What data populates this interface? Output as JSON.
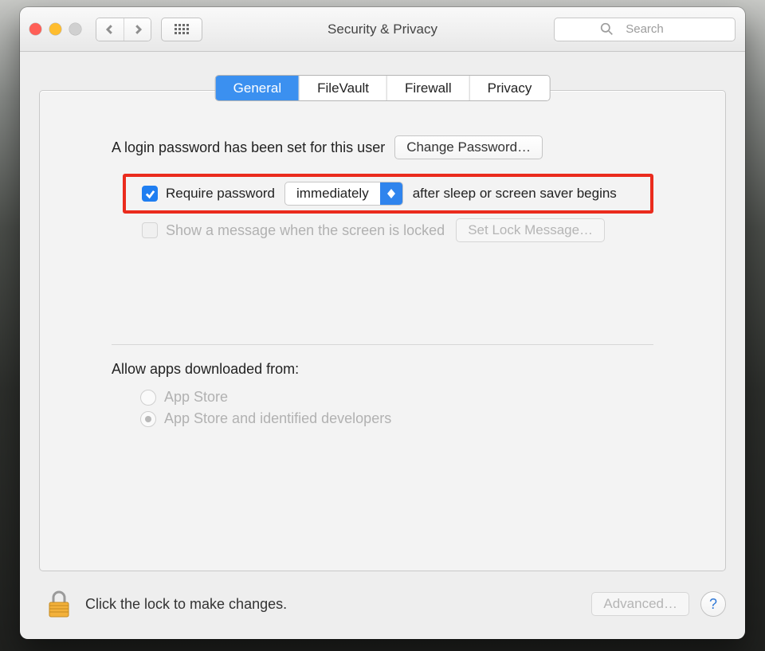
{
  "window": {
    "title": "Security & Privacy"
  },
  "search": {
    "placeholder": "Search"
  },
  "tabs": {
    "t0": "General",
    "t1": "FileVault",
    "t2": "Firewall",
    "t3": "Privacy"
  },
  "loginRow": {
    "text": "A login password has been set for this user",
    "button": "Change Password…"
  },
  "requireRow": {
    "pre": "Require password",
    "select": "immediately",
    "post": "after sleep or screen saver begins"
  },
  "messageRow": {
    "text": "Show a message when the screen is locked",
    "button": "Set Lock Message…"
  },
  "apps": {
    "heading": "Allow apps downloaded from:",
    "opt0": "App Store",
    "opt1": "App Store and identified developers"
  },
  "footer": {
    "text": "Click the lock to make changes.",
    "advanced": "Advanced…",
    "help": "?"
  }
}
